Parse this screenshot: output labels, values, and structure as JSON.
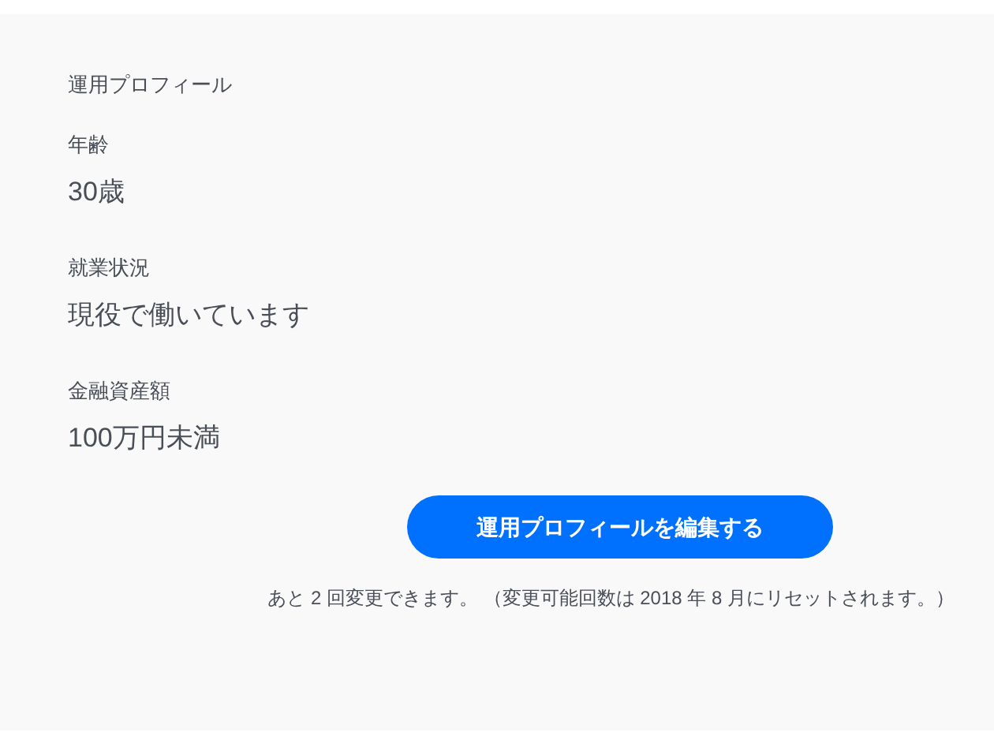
{
  "title": "運用プロフィール",
  "fields": [
    {
      "label": "年齢",
      "value": "30歳"
    },
    {
      "label": "就業状況",
      "value": "現役で働いています"
    },
    {
      "label": "金融資産額",
      "value": "100万円未満"
    }
  ],
  "edit_button": "運用プロフィールを編集する",
  "note": "あと 2 回変更できます。 （変更可能回数は 2018 年 8 月にリセットされます。）"
}
